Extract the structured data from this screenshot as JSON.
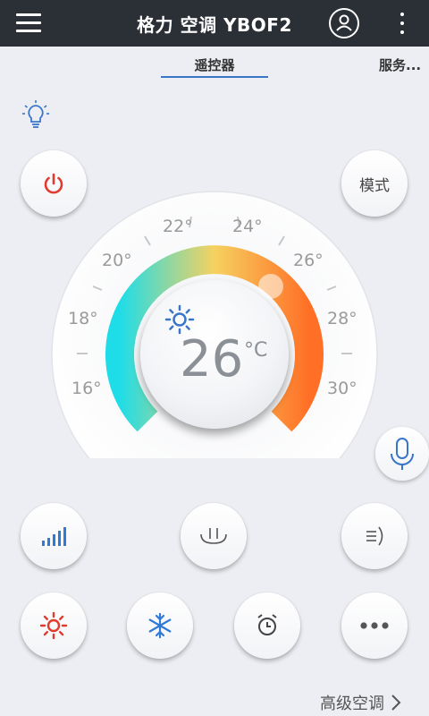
{
  "header": {
    "title": "格力 空调 YBOF2"
  },
  "tabs": [
    {
      "label": "遥控器",
      "active": true
    },
    {
      "label": "服务..."
    }
  ],
  "mode_button": {
    "label": "模式"
  },
  "dial": {
    "scale": [
      "16°",
      "18°",
      "20°",
      "22°",
      "24°",
      "26°",
      "28°",
      "30°"
    ],
    "temperature": "26",
    "unit": "°C",
    "gradient": {
      "cold": "#1fdde8",
      "mid": "#f6d160",
      "hot": "#ff6f26"
    }
  },
  "colors": {
    "header_bg": "#2b2f36",
    "accent": "#3a76c8",
    "power": "#e13b2f",
    "heat": "#e13b2f",
    "cool": "#2f7ad6"
  },
  "icons": {
    "top": [
      "menu-icon",
      "account-icon",
      "more-vertical-icon"
    ],
    "controls": [
      "signal-bars-icon",
      "sleep-icon",
      "swing-icon",
      "sun-icon",
      "snowflake-icon",
      "alarm-clock-icon",
      "ellipsis-icon"
    ]
  },
  "footer": {
    "advanced_label": "高级空调"
  }
}
